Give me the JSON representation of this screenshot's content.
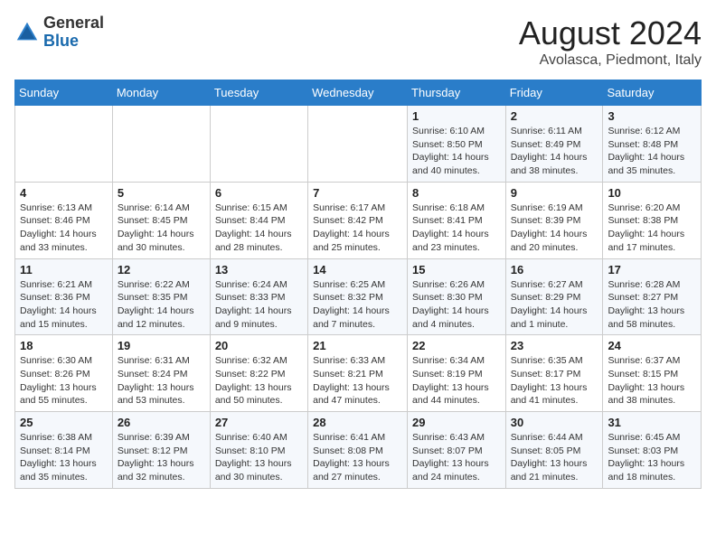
{
  "header": {
    "logo_general": "General",
    "logo_blue": "Blue",
    "month_year": "August 2024",
    "location": "Avolasca, Piedmont, Italy"
  },
  "days_of_week": [
    "Sunday",
    "Monday",
    "Tuesday",
    "Wednesday",
    "Thursday",
    "Friday",
    "Saturday"
  ],
  "weeks": [
    [
      {
        "day": "",
        "info": ""
      },
      {
        "day": "",
        "info": ""
      },
      {
        "day": "",
        "info": ""
      },
      {
        "day": "",
        "info": ""
      },
      {
        "day": "1",
        "info": "Sunrise: 6:10 AM\nSunset: 8:50 PM\nDaylight: 14 hours\nand 40 minutes."
      },
      {
        "day": "2",
        "info": "Sunrise: 6:11 AM\nSunset: 8:49 PM\nDaylight: 14 hours\nand 38 minutes."
      },
      {
        "day": "3",
        "info": "Sunrise: 6:12 AM\nSunset: 8:48 PM\nDaylight: 14 hours\nand 35 minutes."
      }
    ],
    [
      {
        "day": "4",
        "info": "Sunrise: 6:13 AM\nSunset: 8:46 PM\nDaylight: 14 hours\nand 33 minutes."
      },
      {
        "day": "5",
        "info": "Sunrise: 6:14 AM\nSunset: 8:45 PM\nDaylight: 14 hours\nand 30 minutes."
      },
      {
        "day": "6",
        "info": "Sunrise: 6:15 AM\nSunset: 8:44 PM\nDaylight: 14 hours\nand 28 minutes."
      },
      {
        "day": "7",
        "info": "Sunrise: 6:17 AM\nSunset: 8:42 PM\nDaylight: 14 hours\nand 25 minutes."
      },
      {
        "day": "8",
        "info": "Sunrise: 6:18 AM\nSunset: 8:41 PM\nDaylight: 14 hours\nand 23 minutes."
      },
      {
        "day": "9",
        "info": "Sunrise: 6:19 AM\nSunset: 8:39 PM\nDaylight: 14 hours\nand 20 minutes."
      },
      {
        "day": "10",
        "info": "Sunrise: 6:20 AM\nSunset: 8:38 PM\nDaylight: 14 hours\nand 17 minutes."
      }
    ],
    [
      {
        "day": "11",
        "info": "Sunrise: 6:21 AM\nSunset: 8:36 PM\nDaylight: 14 hours\nand 15 minutes."
      },
      {
        "day": "12",
        "info": "Sunrise: 6:22 AM\nSunset: 8:35 PM\nDaylight: 14 hours\nand 12 minutes."
      },
      {
        "day": "13",
        "info": "Sunrise: 6:24 AM\nSunset: 8:33 PM\nDaylight: 14 hours\nand 9 minutes."
      },
      {
        "day": "14",
        "info": "Sunrise: 6:25 AM\nSunset: 8:32 PM\nDaylight: 14 hours\nand 7 minutes."
      },
      {
        "day": "15",
        "info": "Sunrise: 6:26 AM\nSunset: 8:30 PM\nDaylight: 14 hours\nand 4 minutes."
      },
      {
        "day": "16",
        "info": "Sunrise: 6:27 AM\nSunset: 8:29 PM\nDaylight: 14 hours\nand 1 minute."
      },
      {
        "day": "17",
        "info": "Sunrise: 6:28 AM\nSunset: 8:27 PM\nDaylight: 13 hours\nand 58 minutes."
      }
    ],
    [
      {
        "day": "18",
        "info": "Sunrise: 6:30 AM\nSunset: 8:26 PM\nDaylight: 13 hours\nand 55 minutes."
      },
      {
        "day": "19",
        "info": "Sunrise: 6:31 AM\nSunset: 8:24 PM\nDaylight: 13 hours\nand 53 minutes."
      },
      {
        "day": "20",
        "info": "Sunrise: 6:32 AM\nSunset: 8:22 PM\nDaylight: 13 hours\nand 50 minutes."
      },
      {
        "day": "21",
        "info": "Sunrise: 6:33 AM\nSunset: 8:21 PM\nDaylight: 13 hours\nand 47 minutes."
      },
      {
        "day": "22",
        "info": "Sunrise: 6:34 AM\nSunset: 8:19 PM\nDaylight: 13 hours\nand 44 minutes."
      },
      {
        "day": "23",
        "info": "Sunrise: 6:35 AM\nSunset: 8:17 PM\nDaylight: 13 hours\nand 41 minutes."
      },
      {
        "day": "24",
        "info": "Sunrise: 6:37 AM\nSunset: 8:15 PM\nDaylight: 13 hours\nand 38 minutes."
      }
    ],
    [
      {
        "day": "25",
        "info": "Sunrise: 6:38 AM\nSunset: 8:14 PM\nDaylight: 13 hours\nand 35 minutes."
      },
      {
        "day": "26",
        "info": "Sunrise: 6:39 AM\nSunset: 8:12 PM\nDaylight: 13 hours\nand 32 minutes."
      },
      {
        "day": "27",
        "info": "Sunrise: 6:40 AM\nSunset: 8:10 PM\nDaylight: 13 hours\nand 30 minutes."
      },
      {
        "day": "28",
        "info": "Sunrise: 6:41 AM\nSunset: 8:08 PM\nDaylight: 13 hours\nand 27 minutes."
      },
      {
        "day": "29",
        "info": "Sunrise: 6:43 AM\nSunset: 8:07 PM\nDaylight: 13 hours\nand 24 minutes."
      },
      {
        "day": "30",
        "info": "Sunrise: 6:44 AM\nSunset: 8:05 PM\nDaylight: 13 hours\nand 21 minutes."
      },
      {
        "day": "31",
        "info": "Sunrise: 6:45 AM\nSunset: 8:03 PM\nDaylight: 13 hours\nand 18 minutes."
      }
    ]
  ]
}
